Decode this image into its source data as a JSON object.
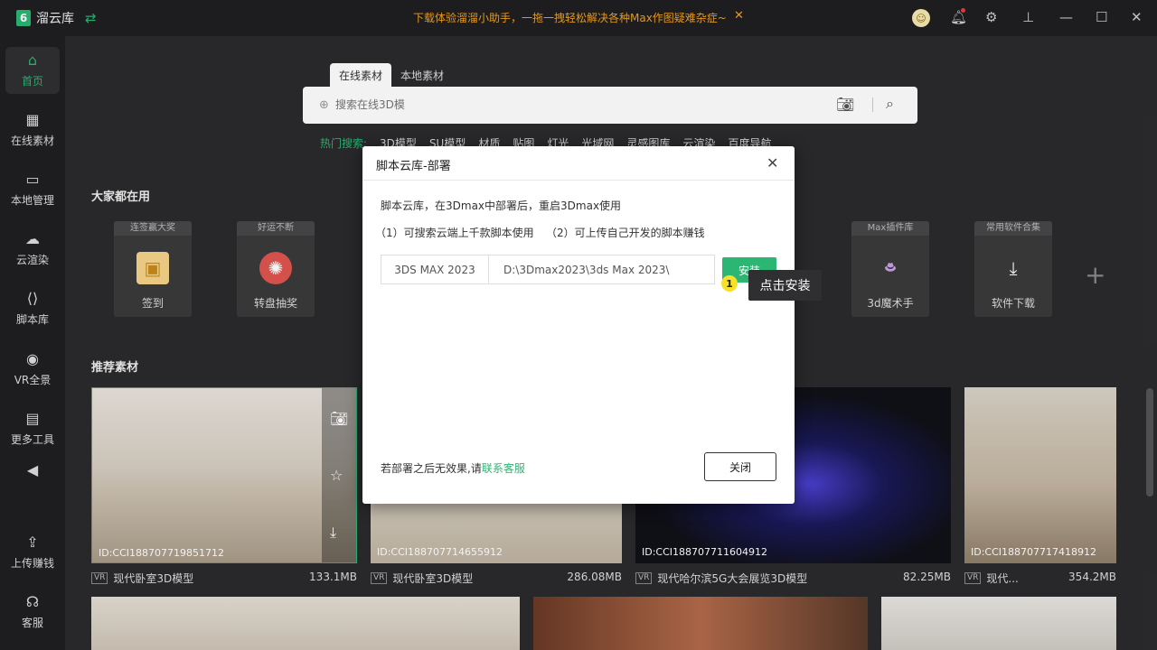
{
  "app": {
    "name": "溜云库",
    "logo_mark": "6"
  },
  "topbar": {
    "promo": "下载体验溜溜小助手，一拖一拽轻松解决各种Max作图疑难杂症~"
  },
  "sidebar": {
    "items": [
      {
        "label": "首页",
        "icon": "home-icon"
      },
      {
        "label": "在线素材",
        "icon": "grid-icon"
      },
      {
        "label": "本地管理",
        "icon": "monitor-icon"
      },
      {
        "label": "云渲染",
        "icon": "cloud-icon"
      },
      {
        "label": "脚本库",
        "icon": "code-icon"
      },
      {
        "label": "VR全景",
        "icon": "vr-icon"
      },
      {
        "label": "更多工具",
        "icon": "toolbox-icon"
      },
      {
        "label": "上传赚钱",
        "icon": "upload-icon"
      },
      {
        "label": "客服",
        "icon": "headset-icon"
      }
    ]
  },
  "search": {
    "tabs": [
      "在线素材",
      "本地素材"
    ],
    "placeholder": "搜索在线3D模",
    "hot_label": "热门搜索:",
    "hot_items": [
      "3D模型",
      "SU模型",
      "材质",
      "贴图",
      "灯光",
      "光域网",
      "灵感图库",
      "云渲染",
      "百度导航"
    ]
  },
  "sections": {
    "popular": "大家都在用",
    "recommended": "推荐素材"
  },
  "tools": [
    {
      "tag": "连签赢大奖",
      "label": "签到",
      "icon": "calendar-icon"
    },
    {
      "tag": "好运不断",
      "label": "转盘抽奖",
      "icon": "wheel-icon"
    },
    {
      "tag": "Max插件库",
      "label": "3d魔术手",
      "icon": "magic-hat-icon"
    },
    {
      "tag": "常用软件合集",
      "label": "软件下载",
      "icon": "download-box-icon"
    }
  ],
  "models": [
    {
      "id": "ID:CCI188707719851712",
      "title": "现代卧室3D模型",
      "size": "133.1MB",
      "vr": "VR"
    },
    {
      "id": "ID:CCI188707714655912",
      "title": "现代卧室3D模型",
      "size": "286.08MB",
      "vr": "VR"
    },
    {
      "id": "ID:CCI188707711604912",
      "title": "现代哈尔滨5G大会展览3D模型",
      "size": "82.25MB",
      "vr": "VR"
    },
    {
      "id": "ID:CCI188707717418912",
      "title": "现代...",
      "size": "354.2MB",
      "vr": "VR"
    }
  ],
  "dialog": {
    "title": "脚本云库-部署",
    "desc": "脚本云库，在3Dmax中部署后，重启3Dmax使用",
    "point1": "（1）可搜索云端上千款脚本使用",
    "point2": "（2）可上传自己开发的脚本赚钱",
    "version": "3DS MAX 2023",
    "path": "D:\\3Dmax2023\\3ds Max 2023\\",
    "install": "安装",
    "step_number": "1",
    "tooltip": "点击安装",
    "footer_text": "若部署之后无效果,请",
    "footer_link": "联系客服",
    "close": "关闭"
  },
  "colors": {
    "accent": "#2bb673",
    "promo": "#f0a020",
    "badge": "#f5e02a"
  }
}
